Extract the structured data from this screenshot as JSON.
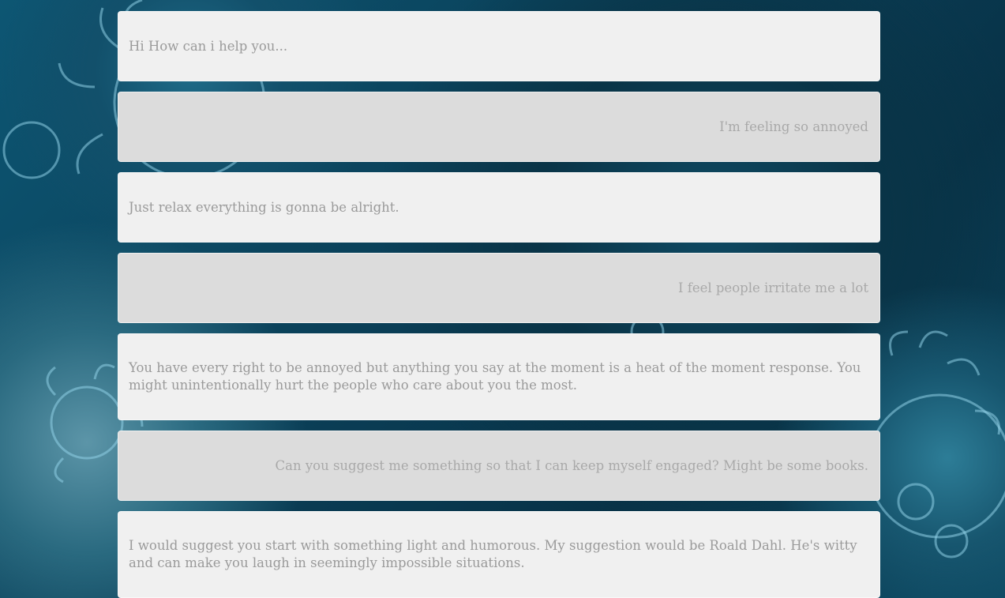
{
  "chat": {
    "messages": [
      {
        "role": "bot",
        "text": "Hi How can i help you..."
      },
      {
        "role": "user",
        "text": "I'm feeling so annoyed"
      },
      {
        "role": "bot",
        "text": "Just relax everything is gonna be alright."
      },
      {
        "role": "user",
        "text": "I feel people irritate me a lot"
      },
      {
        "role": "bot",
        "text": "You have every right to be annoyed but anything you say at the moment is a heat of the moment response. You might unintentionally hurt the people who care about you the most."
      },
      {
        "role": "user",
        "text": "Can you suggest me something so that I can keep myself engaged? Might be some books."
      },
      {
        "role": "bot",
        "text": "I would suggest you start with something light and humorous. My suggestion would be Roald Dahl. He's witty and can make you laugh in seemingly impossible situations."
      }
    ]
  },
  "colors": {
    "background": "#0a3e56",
    "bot_bubble": "#f0f0f0",
    "user_bubble": "#dcdcdc",
    "text": "#9a9a9a"
  }
}
